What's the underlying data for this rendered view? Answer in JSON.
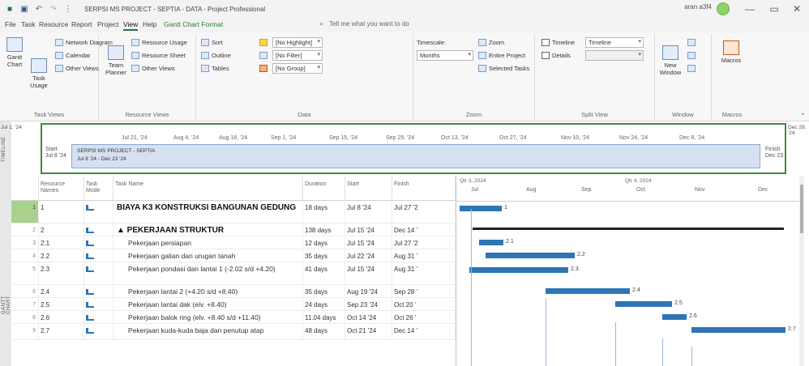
{
  "window": {
    "title": "SERPSI MS PROJECT - SEPTIA - DATA  -  Project Professional",
    "user": "aran a3f4",
    "minimize": "—",
    "restore": "▭",
    "close": "✕"
  },
  "menu": {
    "tabs": [
      "File",
      "Task",
      "Resource",
      "Report",
      "Project",
      "View",
      "Help",
      "Gantt Chart Format"
    ],
    "active_tab": "View",
    "tell_me": "Tell me what you want to do"
  },
  "ribbon": {
    "task_views": {
      "label": "Task Views",
      "gantt": "Gantt Chart",
      "task_usage": "Task Usage",
      "network": "Network Diagram",
      "calendar": "Calendar",
      "other": "Other Views"
    },
    "resource_views": {
      "label": "Resource Views",
      "team_planner": "Team Planner",
      "usage": "Resource Usage",
      "sheet": "Resource Sheet",
      "other": "Other Views"
    },
    "data": {
      "label": "Data",
      "sort": "Sort",
      "outline": "Outline",
      "tables": "Tables",
      "highlight": "[No Highlight]",
      "filter": "[No Filter]",
      "group": "[No Group]"
    },
    "zoom": {
      "label": "Zoom",
      "timescale_label": "Timescale:",
      "timescale": "Months",
      "zoom": "Zoom",
      "entire": "Entire Project",
      "selected": "Selected Tasks"
    },
    "split_view": {
      "label": "Split View",
      "timeline": "Timeline",
      "timeline_value": "Timeline",
      "details": "Details"
    },
    "window": {
      "label": "Window",
      "new": "New Window"
    },
    "macros": {
      "label": "Macros",
      "macros": "Macros"
    }
  },
  "timeline": {
    "side_label": "TIMELINE",
    "left_date": "Jul 1, '24",
    "right_date": "Dec 29, '24",
    "start_label": "Start",
    "start_date": "Jul 8 '24",
    "finish_label": "Finish",
    "finish_date": "Dec 23",
    "ticks": [
      "Jul 21, '24",
      "Aug 4, '24",
      "Aug 18, '24",
      "Sep 1, '24",
      "Sep 15, '24",
      "Sep 29, '24",
      "Oct 13, '24",
      "Oct 27, '24",
      "Nov 10, '24",
      "Nov 24, '24",
      "Dec 8, '24"
    ],
    "bar_name": "SERPSI MS PROJECT - SEPTIA",
    "bar_dates": "Jul 8 '24 - Dec 23 '24"
  },
  "gantt": {
    "side_label": "GANTT CHART",
    "headers": {
      "resource_names": "Resource Names",
      "task_mode": "Task Mode",
      "task_name": "Task Name",
      "duration": "Duration",
      "start": "Start",
      "finish": "Finish"
    },
    "quarters": [
      "Qtr 3, 2024",
      "Qtr 4, 2024"
    ],
    "months": [
      "Jul",
      "Aug",
      "Sep",
      "Oct",
      "Nov",
      "Dec"
    ],
    "rows": [
      {
        "id": "1",
        "res": "1",
        "name": "BIAYA K3 KONSTRUKSI BANGUNAN GEDUNG",
        "duration": "18 days",
        "start": "Jul 8 '24",
        "finish": "Jul 27 '2",
        "bar_label": "1"
      },
      {
        "id": "2",
        "res": "2",
        "name": "▲ PEKERJAAN STRUKTUR",
        "duration": "138 days",
        "start": "Jul 15 '24",
        "finish": "Dec 14 '",
        "bar_label": ""
      },
      {
        "id": "3",
        "res": "2.1",
        "name": "Pekerjaan persiapan",
        "duration": "12 days",
        "start": "Jul 15 '24",
        "finish": "Jul 27 '2",
        "bar_label": "2.1"
      },
      {
        "id": "4",
        "res": "2.2",
        "name": "Pekerjaan galian dan urugan tanah",
        "duration": "35 days",
        "start": "Jul 22 '24",
        "finish": "Aug 31 '",
        "bar_label": "2.2"
      },
      {
        "id": "5",
        "res": "2.3",
        "name": "Pekerjaan pondasi dan lantai 1 (-2.02 s/d +4.20)",
        "duration": "41 days",
        "start": "Jul 15 '24",
        "finish": "Aug 31 '",
        "bar_label": "2.3"
      },
      {
        "id": "6",
        "res": "2.4",
        "name": "Pekerjaan lantai 2 (+4.20 s/d +8.40)",
        "duration": "35 days",
        "start": "Aug 19 '24",
        "finish": "Sep 28 '",
        "bar_label": "2.4"
      },
      {
        "id": "7",
        "res": "2.5",
        "name": "Pekerjaan lantai dak (elv. +8.40)",
        "duration": "24 days",
        "start": "Sep 23 '24",
        "finish": "Oct 20 '",
        "bar_label": "2.5"
      },
      {
        "id": "8",
        "res": "2.6",
        "name": "Pekerjaan balok ring (elv. +8.40 s/d +11.40)",
        "duration": "11.04 days",
        "start": "Oct 14 '24",
        "finish": "Oct 26 '",
        "bar_label": "2.6"
      },
      {
        "id": "9",
        "res": "2.7",
        "name": "Pekerjaan kuda-kuda baja dan penutup atap",
        "duration": "48 days",
        "start": "Oct 21 '24",
        "finish": "Dec 14 '",
        "bar_label": "2.7"
      }
    ]
  }
}
